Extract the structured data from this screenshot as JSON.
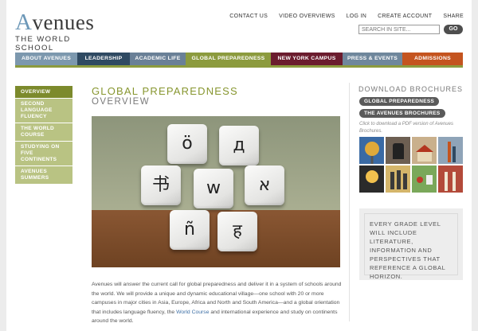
{
  "brand": {
    "name": "Avenues",
    "tagline": "THE WORLD SCHOOL"
  },
  "utility_nav": [
    "CONTACT US",
    "VIDEO OVERVIEWS",
    "LOG IN",
    "CREATE ACCOUNT",
    "SHARE"
  ],
  "search": {
    "placeholder": "SEARCH IN SITE...",
    "button": "GO"
  },
  "main_nav": [
    {
      "label": "ABOUT AVENUES",
      "color": "#7c98ae"
    },
    {
      "label": "LEADERSHIP",
      "color": "#2f4a62"
    },
    {
      "label": "ACADEMIC LIFE",
      "color": "#6a8097"
    },
    {
      "label": "GLOBAL PREPAREDNESS",
      "color": "#8c9b3e"
    },
    {
      "label": "NEW YORK CAMPUS",
      "color": "#6b1c2e"
    },
    {
      "label": "PRESS & EVENTS",
      "color": "#6f879c"
    },
    {
      "label": "ADMISSIONS",
      "color": "#c4541f"
    }
  ],
  "side_nav": [
    {
      "label": "OVERVIEW",
      "active": true
    },
    {
      "label": "SECOND LANGUAGE FLUENCY",
      "active": false
    },
    {
      "label": "THE WORLD COURSE",
      "active": false
    },
    {
      "label": "STUDYING ON FIVE CONTINENTS",
      "active": false
    },
    {
      "label": "AVENUES SUMMERS",
      "active": false
    }
  ],
  "page": {
    "title": "GLOBAL PREPAREDNESS",
    "subtitle": "OVERVIEW",
    "hero_tiles": [
      "ö",
      "д",
      "书",
      "w",
      "א",
      "ñ",
      "ह"
    ],
    "body_before_link": "Avenues will answer the current call for global preparedness and deliver it in a system of schools around the world. We will provide a unique and dynamic educational village—one school with 20 or more campuses in major cities in Asia, Europe, Africa and North and South America—and a global orientation that includes language fluency, the ",
    "body_link": "World Course",
    "body_after_link": " and international experience and study on continents around the world."
  },
  "brochures": {
    "title": "DOWNLOAD BROCHURES",
    "buttons": [
      "GLOBAL PREPAREDNESS",
      "THE AVENUES BROCHURES"
    ],
    "note": "Click to download a PDF version of Avenues Brochures."
  },
  "quote": "EVERY GRADE LEVEL WILL INCLUDE LITERATURE, INFORMATION AND PERSPECTIVES THAT REFERENCE A GLOBAL HORIZON."
}
